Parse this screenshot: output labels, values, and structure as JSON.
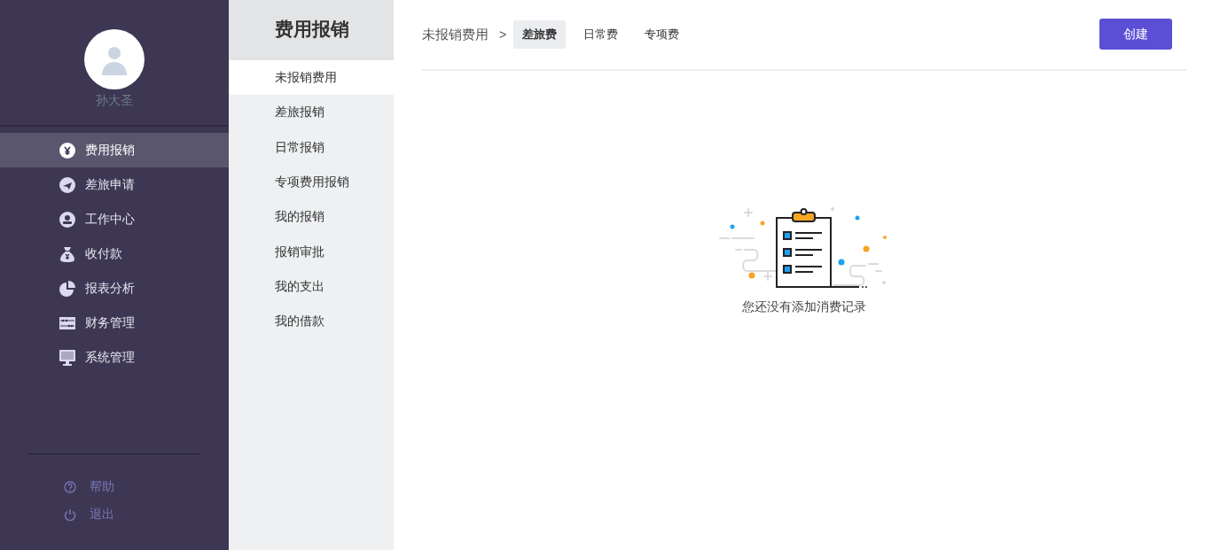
{
  "sidebar": {
    "user_name": "孙大圣",
    "items": [
      {
        "label": "费用报销",
        "selected": true
      },
      {
        "label": "差旅申请",
        "selected": false
      },
      {
        "label": "工作中心",
        "selected": false
      },
      {
        "label": "收付款",
        "selected": false
      },
      {
        "label": "报表分析",
        "selected": false
      },
      {
        "label": "财务管理",
        "selected": false
      },
      {
        "label": "系统管理",
        "selected": false
      }
    ],
    "footer_links": [
      {
        "label": "帮助",
        "kind": "help"
      },
      {
        "label": "退出",
        "kind": "logout"
      }
    ]
  },
  "submenu": {
    "title": "费用报销",
    "items": [
      {
        "label": "未报销费用",
        "selected": true
      },
      {
        "label": "差旅报销",
        "selected": false
      },
      {
        "label": "日常报销",
        "selected": false
      },
      {
        "label": "专项费用报销",
        "selected": false
      },
      {
        "label": "我的报销",
        "selected": false
      },
      {
        "label": "报销审批",
        "selected": false
      },
      {
        "label": "我的支出",
        "selected": false
      },
      {
        "label": "我的借款",
        "selected": false
      }
    ]
  },
  "main": {
    "breadcrumb": "未报销费用",
    "separator": ">",
    "tabs": [
      {
        "label": "差旅费",
        "selected": true
      },
      {
        "label": "日常费",
        "selected": false
      },
      {
        "label": "专项费",
        "selected": false
      }
    ],
    "create_button": "创建",
    "empty_message": "您还没有添加消费记录"
  }
}
